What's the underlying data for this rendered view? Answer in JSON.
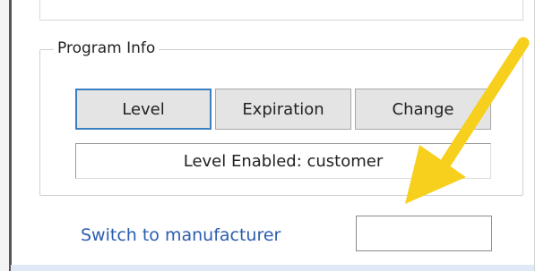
{
  "program_info": {
    "legend": "Program Info",
    "buttons": {
      "level": "Level",
      "expiration": "Expiration",
      "change": "Change"
    },
    "status_text": "Level Enabled: customer"
  },
  "switch": {
    "link_label": "Switch to manufacturer",
    "input_value": ""
  },
  "annotation": {
    "arrow_color": "#f7cf1d"
  },
  "colors": {
    "link": "#2a5db0",
    "focus_border": "#3a7fc1",
    "button_bg": "#e4e4e4"
  }
}
